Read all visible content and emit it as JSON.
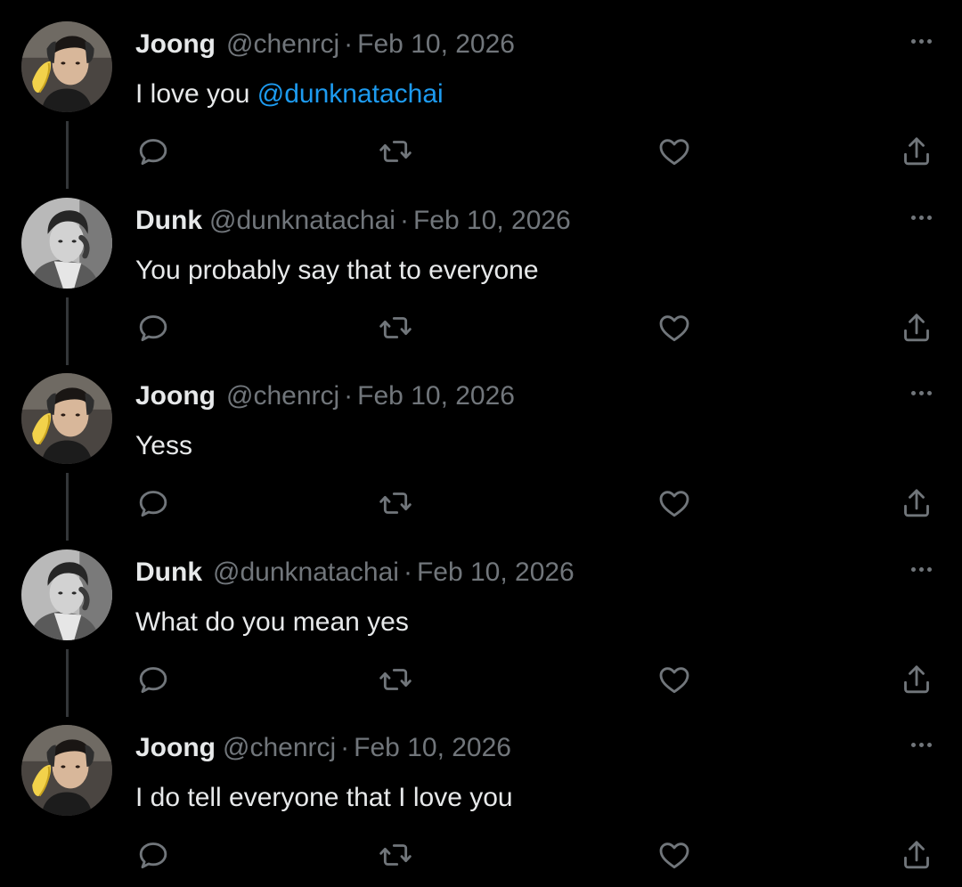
{
  "colors": {
    "background": "#000000",
    "primary_text": "#e7e9ea",
    "secondary_text": "#71767b",
    "mention": "#1d9bf0",
    "thread_line": "#333639"
  },
  "icons": {
    "reply": "speech-bubble-icon",
    "retweet": "retweet-arrows-icon",
    "like": "heart-outline-icon",
    "share": "share-upload-icon",
    "more": "three-dots-icon"
  },
  "tweets": [
    {
      "author": "Joong",
      "handle": "@chenrcj",
      "separator": "·",
      "date": "Feb 10, 2026",
      "text": "I love you",
      "mention": "@dunknatachai"
    },
    {
      "author": "Dunk",
      "handle": "@dunknatachai",
      "separator": "·",
      "date": "Feb 10, 2026",
      "text": "You probably say that to everyone"
    },
    {
      "author": "Joong",
      "handle": "@chenrcj",
      "separator": "·",
      "date": "Feb 10, 2026",
      "text": "Yess"
    },
    {
      "author": "Dunk",
      "handle": "@dunknatachai",
      "separator": "·",
      "date": "Feb 10, 2026",
      "text": "What do you mean yes"
    },
    {
      "author": "Joong",
      "handle": "@chenrcj",
      "separator": "·",
      "date": "Feb 10, 2026",
      "text": "I do tell everyone that I love you"
    }
  ]
}
